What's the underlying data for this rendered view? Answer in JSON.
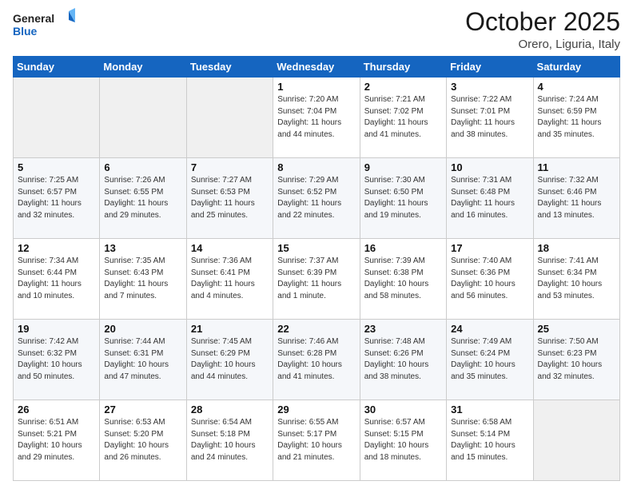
{
  "header": {
    "logo_general": "General",
    "logo_blue": "Blue",
    "month": "October 2025",
    "location": "Orero, Liguria, Italy"
  },
  "weekdays": [
    "Sunday",
    "Monday",
    "Tuesday",
    "Wednesday",
    "Thursday",
    "Friday",
    "Saturday"
  ],
  "weeks": [
    [
      {
        "day": "",
        "info": ""
      },
      {
        "day": "",
        "info": ""
      },
      {
        "day": "",
        "info": ""
      },
      {
        "day": "1",
        "info": "Sunrise: 7:20 AM\nSunset: 7:04 PM\nDaylight: 11 hours and 44 minutes."
      },
      {
        "day": "2",
        "info": "Sunrise: 7:21 AM\nSunset: 7:02 PM\nDaylight: 11 hours and 41 minutes."
      },
      {
        "day": "3",
        "info": "Sunrise: 7:22 AM\nSunset: 7:01 PM\nDaylight: 11 hours and 38 minutes."
      },
      {
        "day": "4",
        "info": "Sunrise: 7:24 AM\nSunset: 6:59 PM\nDaylight: 11 hours and 35 minutes."
      }
    ],
    [
      {
        "day": "5",
        "info": "Sunrise: 7:25 AM\nSunset: 6:57 PM\nDaylight: 11 hours and 32 minutes."
      },
      {
        "day": "6",
        "info": "Sunrise: 7:26 AM\nSunset: 6:55 PM\nDaylight: 11 hours and 29 minutes."
      },
      {
        "day": "7",
        "info": "Sunrise: 7:27 AM\nSunset: 6:53 PM\nDaylight: 11 hours and 25 minutes."
      },
      {
        "day": "8",
        "info": "Sunrise: 7:29 AM\nSunset: 6:52 PM\nDaylight: 11 hours and 22 minutes."
      },
      {
        "day": "9",
        "info": "Sunrise: 7:30 AM\nSunset: 6:50 PM\nDaylight: 11 hours and 19 minutes."
      },
      {
        "day": "10",
        "info": "Sunrise: 7:31 AM\nSunset: 6:48 PM\nDaylight: 11 hours and 16 minutes."
      },
      {
        "day": "11",
        "info": "Sunrise: 7:32 AM\nSunset: 6:46 PM\nDaylight: 11 hours and 13 minutes."
      }
    ],
    [
      {
        "day": "12",
        "info": "Sunrise: 7:34 AM\nSunset: 6:44 PM\nDaylight: 11 hours and 10 minutes."
      },
      {
        "day": "13",
        "info": "Sunrise: 7:35 AM\nSunset: 6:43 PM\nDaylight: 11 hours and 7 minutes."
      },
      {
        "day": "14",
        "info": "Sunrise: 7:36 AM\nSunset: 6:41 PM\nDaylight: 11 hours and 4 minutes."
      },
      {
        "day": "15",
        "info": "Sunrise: 7:37 AM\nSunset: 6:39 PM\nDaylight: 11 hours and 1 minute."
      },
      {
        "day": "16",
        "info": "Sunrise: 7:39 AM\nSunset: 6:38 PM\nDaylight: 10 hours and 58 minutes."
      },
      {
        "day": "17",
        "info": "Sunrise: 7:40 AM\nSunset: 6:36 PM\nDaylight: 10 hours and 56 minutes."
      },
      {
        "day": "18",
        "info": "Sunrise: 7:41 AM\nSunset: 6:34 PM\nDaylight: 10 hours and 53 minutes."
      }
    ],
    [
      {
        "day": "19",
        "info": "Sunrise: 7:42 AM\nSunset: 6:32 PM\nDaylight: 10 hours and 50 minutes."
      },
      {
        "day": "20",
        "info": "Sunrise: 7:44 AM\nSunset: 6:31 PM\nDaylight: 10 hours and 47 minutes."
      },
      {
        "day": "21",
        "info": "Sunrise: 7:45 AM\nSunset: 6:29 PM\nDaylight: 10 hours and 44 minutes."
      },
      {
        "day": "22",
        "info": "Sunrise: 7:46 AM\nSunset: 6:28 PM\nDaylight: 10 hours and 41 minutes."
      },
      {
        "day": "23",
        "info": "Sunrise: 7:48 AM\nSunset: 6:26 PM\nDaylight: 10 hours and 38 minutes."
      },
      {
        "day": "24",
        "info": "Sunrise: 7:49 AM\nSunset: 6:24 PM\nDaylight: 10 hours and 35 minutes."
      },
      {
        "day": "25",
        "info": "Sunrise: 7:50 AM\nSunset: 6:23 PM\nDaylight: 10 hours and 32 minutes."
      }
    ],
    [
      {
        "day": "26",
        "info": "Sunrise: 6:51 AM\nSunset: 5:21 PM\nDaylight: 10 hours and 29 minutes."
      },
      {
        "day": "27",
        "info": "Sunrise: 6:53 AM\nSunset: 5:20 PM\nDaylight: 10 hours and 26 minutes."
      },
      {
        "day": "28",
        "info": "Sunrise: 6:54 AM\nSunset: 5:18 PM\nDaylight: 10 hours and 24 minutes."
      },
      {
        "day": "29",
        "info": "Sunrise: 6:55 AM\nSunset: 5:17 PM\nDaylight: 10 hours and 21 minutes."
      },
      {
        "day": "30",
        "info": "Sunrise: 6:57 AM\nSunset: 5:15 PM\nDaylight: 10 hours and 18 minutes."
      },
      {
        "day": "31",
        "info": "Sunrise: 6:58 AM\nSunset: 5:14 PM\nDaylight: 10 hours and 15 minutes."
      },
      {
        "day": "",
        "info": ""
      }
    ]
  ]
}
